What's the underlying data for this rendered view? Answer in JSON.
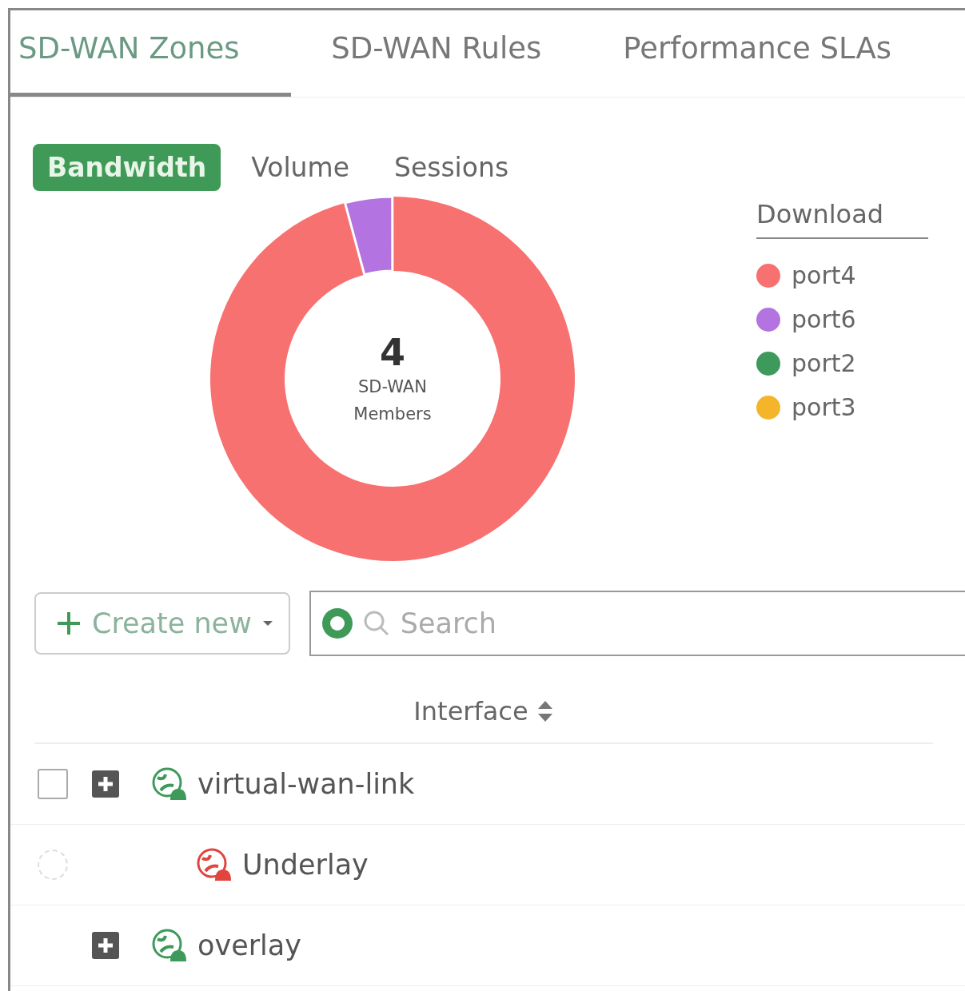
{
  "tabs": [
    {
      "label": "SD-WAN Zones",
      "selected": true
    },
    {
      "label": "SD-WAN Rules",
      "selected": false
    },
    {
      "label": "Performance SLAs",
      "selected": false
    }
  ],
  "subtabs": [
    {
      "label": "Bandwidth",
      "selected": true
    },
    {
      "label": "Volume",
      "selected": false
    },
    {
      "label": "Sessions",
      "selected": false
    }
  ],
  "chart": {
    "center_value": "4",
    "center_label": "SD-WAN Members",
    "legend_title": "Download",
    "legend": [
      {
        "label": "port4",
        "color": "#f87171"
      },
      {
        "label": "port6",
        "color": "#b373e0"
      },
      {
        "label": "port2",
        "color": "#3d9a5a"
      },
      {
        "label": "port3",
        "color": "#f5b52a"
      }
    ]
  },
  "toolbar": {
    "create_button": "Create new",
    "search": {
      "placeholder": "Search"
    }
  },
  "table": {
    "column": "Interface",
    "rows": [
      {
        "kind": "selectable-zone",
        "name": "virtual-wan-link",
        "color": "#3d9a5a",
        "checked": false
      },
      {
        "kind": "member",
        "name": "Underlay",
        "color": "#e0453e",
        "checked": false
      },
      {
        "kind": "zone",
        "name": "overlay",
        "color": "#3d9a5a"
      }
    ]
  }
}
